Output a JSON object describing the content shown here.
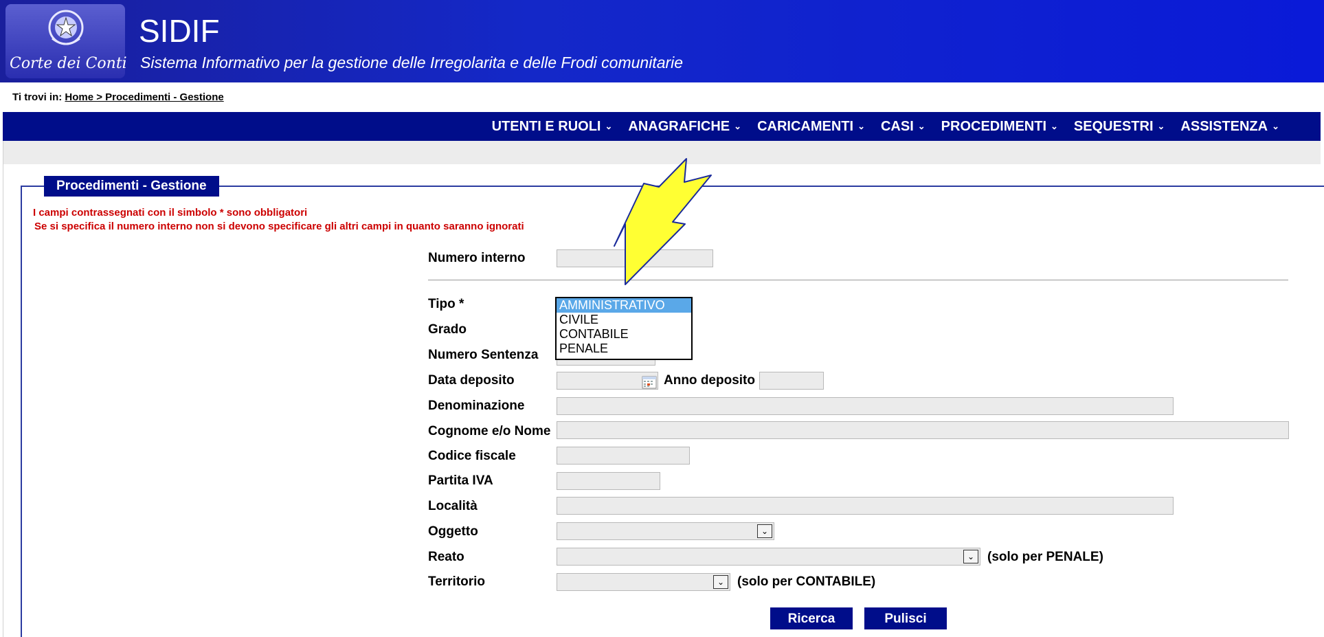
{
  "header": {
    "logo_text": "Corte dei Conti",
    "title": "SIDIF",
    "subtitle": "Sistema Informativo per la gestione delle Irregolarita e delle Frodi comunitarie"
  },
  "breadcrumb": {
    "prefix": "Ti trovi in:",
    "path": "Home > Procedimenti - Gestione"
  },
  "nav": {
    "items": [
      {
        "label": "UTENTI E RUOLI"
      },
      {
        "label": "ANAGRAFICHE"
      },
      {
        "label": "CARICAMENTI"
      },
      {
        "label": "CASI"
      },
      {
        "label": "PROCEDIMENTI"
      },
      {
        "label": "SEQUESTRI"
      },
      {
        "label": "ASSISTENZA"
      }
    ],
    "chevron": "⌄"
  },
  "form": {
    "legend": "Procedimenti - Gestione",
    "note1": "I campi contrassegnati con il simbolo * sono obbligatori",
    "note2": "Se si specifica il numero interno non si devono specificare gli altri campi in quanto saranno ignorati",
    "labels": {
      "numero_interno": "Numero interno",
      "tipo": "Tipo *",
      "grado": "Grado",
      "numero_sentenza": "Numero Sentenza",
      "data_deposito": "Data deposito",
      "anno_deposito": "Anno deposito",
      "denominazione": "Denominazione",
      "cognome_nome": "Cognome e/o Nome",
      "codice_fiscale": "Codice fiscale",
      "partita_iva": "Partita IVA",
      "localita": "Località",
      "oggetto": "Oggetto",
      "reato": "Reato",
      "territorio": "Territorio"
    },
    "hints": {
      "reato": "(solo per PENALE)",
      "territorio": "(solo per CONTABILE)"
    },
    "tipo_options": [
      "AMMINISTRATIVO",
      "CIVILE",
      "CONTABILE",
      "PENALE"
    ],
    "tipo_highlighted": "AMMINISTRATIVO",
    "buttons": {
      "search": "Ricerca",
      "clear": "Pulisci"
    }
  },
  "colors": {
    "header": "#1428c8",
    "navbar": "#000d8a",
    "note": "#cc0000",
    "dropdown_highlight": "#5aa8e8",
    "annotation_arrow": "#ffff33"
  }
}
